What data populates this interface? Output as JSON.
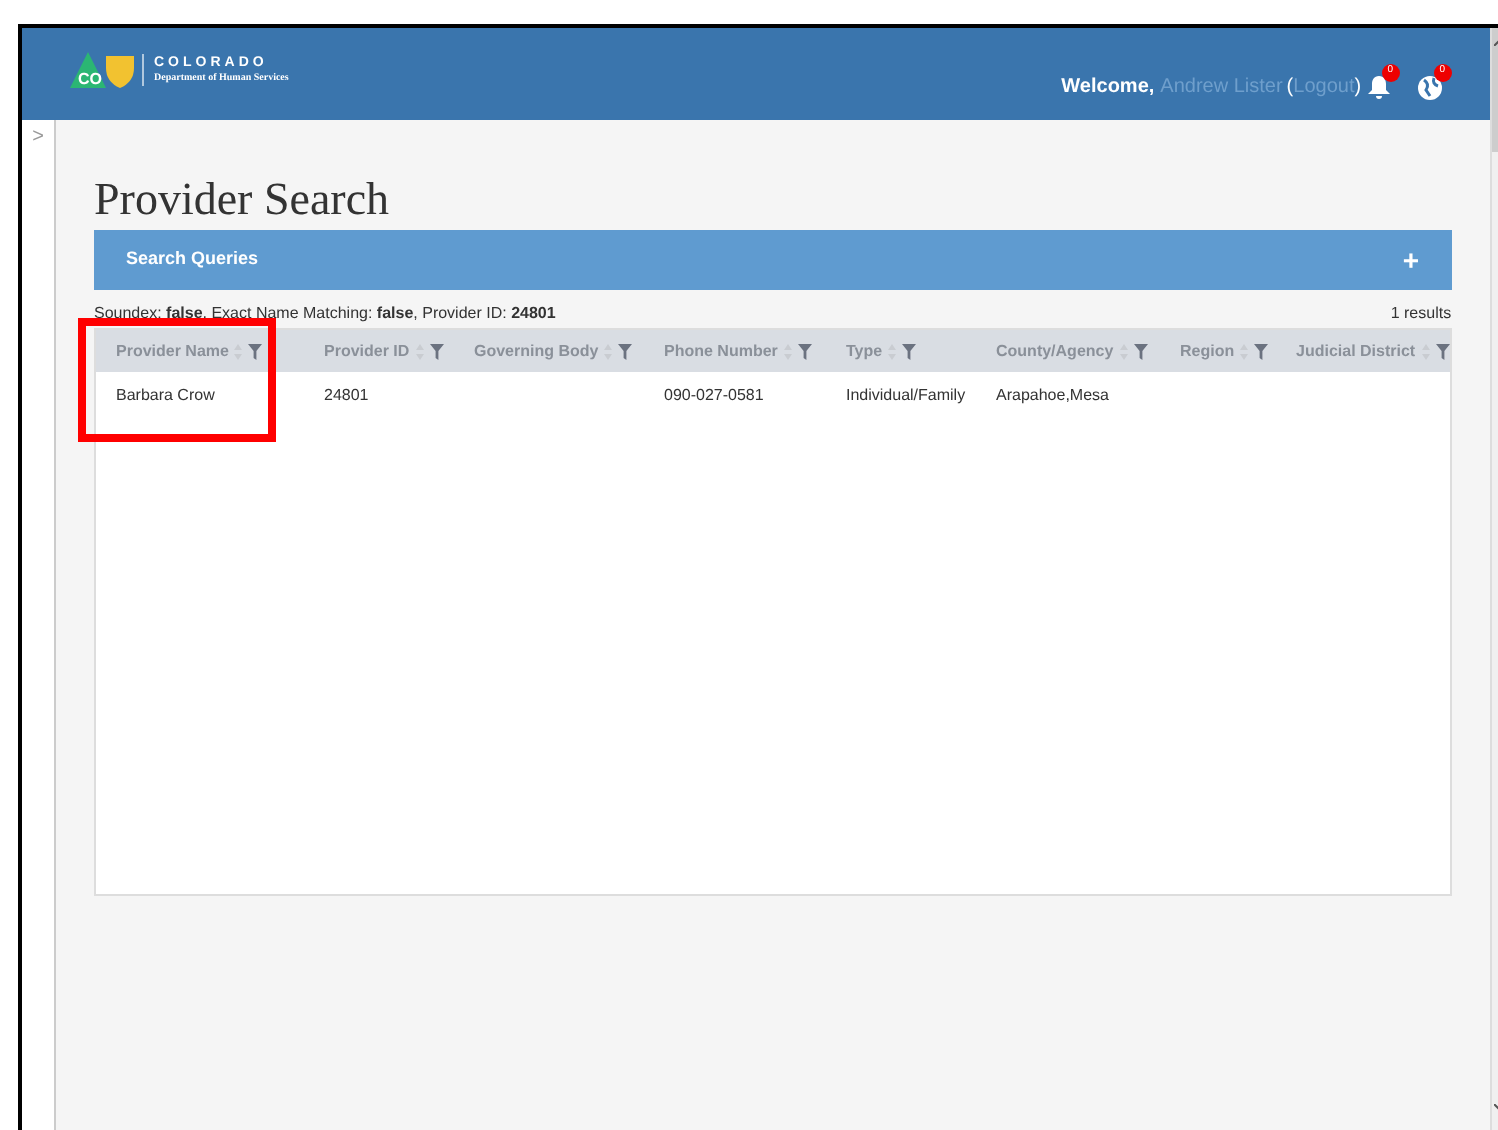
{
  "header": {
    "logo_badge": "CO",
    "org_name": "COLORADO",
    "org_subtitle": "Department of Human Services",
    "greeting": "Welcome,",
    "user": "Andrew Lister",
    "open_paren": "(",
    "logout": "Logout",
    "close_paren": ")",
    "notifications": "0",
    "alerts": "0"
  },
  "sidebar_toggle": ">",
  "page_title": "Provider Search",
  "search_panel": {
    "title": "Search Queries",
    "add": "+"
  },
  "criteria": "Soundex: **false**, Exact Name Matching: **false**, Provider ID: **24801**",
  "result_count": "1 results",
  "table": {
    "columns": [
      "Provider Name",
      "Provider ID",
      "Governing Body",
      "Phone Number",
      "Type",
      "County/Agency",
      "Region",
      "Judicial District"
    ],
    "rows": [
      [
        "Barbara Crow",
        "24801",
        "",
        "090-027-0581",
        "Individual/Family",
        "Arapahoe,Mesa",
        "",
        ""
      ]
    ]
  }
}
